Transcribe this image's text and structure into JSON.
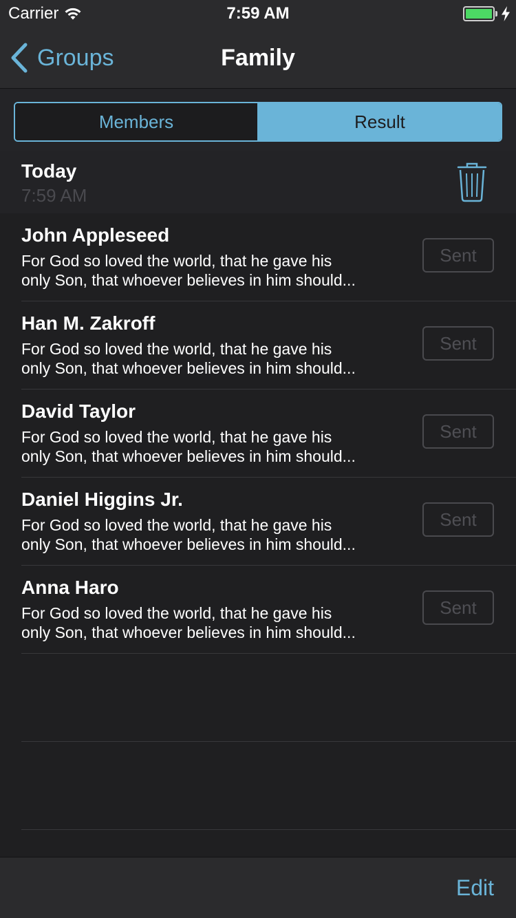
{
  "status_bar": {
    "carrier": "Carrier",
    "time": "7:59 AM",
    "battery_level": 1.0
  },
  "nav": {
    "back_label": "Groups",
    "title": "Family"
  },
  "segments": [
    {
      "label": "Members",
      "selected": false
    },
    {
      "label": "Result",
      "selected": true
    }
  ],
  "section": {
    "title": "Today",
    "time": "7:59 AM"
  },
  "rows": [
    {
      "name": "John Appleseed",
      "line1": "For God so loved the world, that he gave his",
      "line2": "only Son, that whoever believes in him should...",
      "status": "Sent"
    },
    {
      "name": "Han M. Zakroff",
      "line1": "For God so loved the world, that he gave his",
      "line2": "only Son, that whoever believes in him should...",
      "status": "Sent"
    },
    {
      "name": "David Taylor",
      "line1": "For God so loved the world, that he gave his",
      "line2": "only Son, that whoever believes in him should...",
      "status": "Sent"
    },
    {
      "name": "Daniel Higgins Jr.",
      "line1": "For God so loved the world, that he gave his",
      "line2": "only Son, that whoever believes in him should...",
      "status": "Sent"
    },
    {
      "name": "Anna Haro",
      "line1": "For God so loved the world, that he gave his",
      "line2": "only Son, that whoever believes in him should...",
      "status": "Sent"
    }
  ],
  "toolbar": {
    "edit_label": "Edit"
  },
  "colors": {
    "accent": "#6ab4d8",
    "background": "#1f1f21",
    "bar": "#2b2b2d",
    "battery": "#4cd964"
  },
  "icons": {
    "back": "chevron-left-icon",
    "trash": "trash-icon",
    "wifi": "wifi-icon",
    "battery": "battery-icon",
    "charging": "bolt-icon"
  }
}
